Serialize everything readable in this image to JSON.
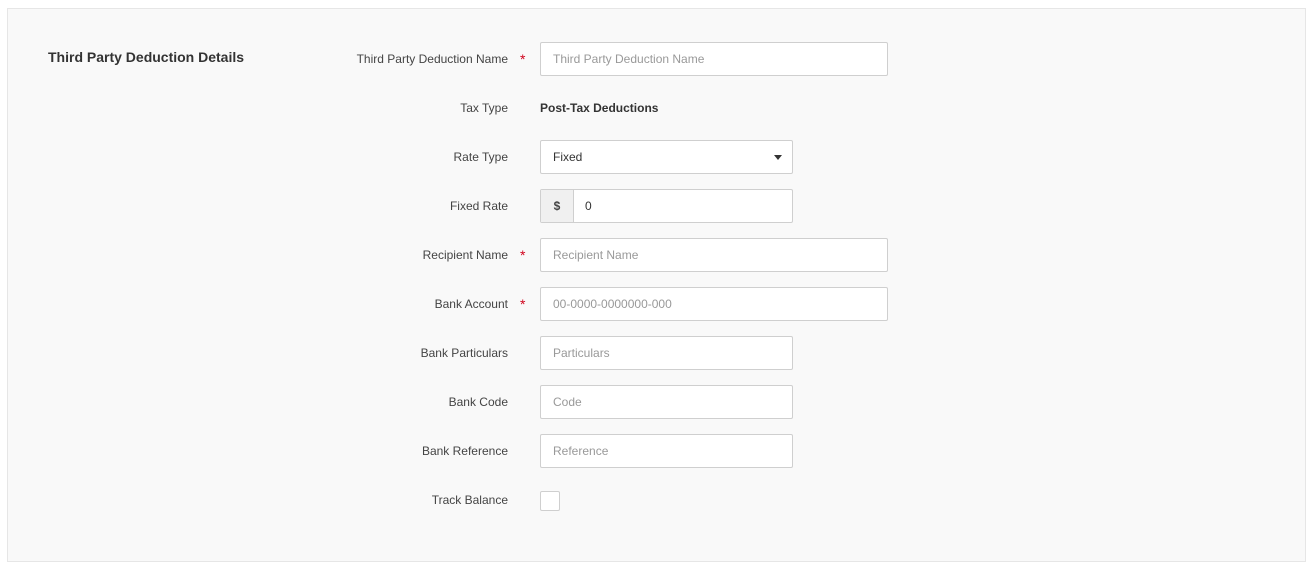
{
  "section": {
    "title": "Third Party Deduction Details"
  },
  "form": {
    "deduction_name": {
      "label": "Third Party Deduction Name",
      "required": "*",
      "placeholder": "Third Party Deduction Name",
      "value": ""
    },
    "tax_type": {
      "label": "Tax Type",
      "value": "Post-Tax Deductions"
    },
    "rate_type": {
      "label": "Rate Type",
      "value": "Fixed"
    },
    "fixed_rate": {
      "label": "Fixed Rate",
      "prefix": "$",
      "value": "0"
    },
    "recipient_name": {
      "label": "Recipient Name",
      "required": "*",
      "placeholder": "Recipient Name",
      "value": ""
    },
    "bank_account": {
      "label": "Bank Account",
      "required": "*",
      "placeholder": "00-0000-0000000-000",
      "value": ""
    },
    "bank_particulars": {
      "label": "Bank Particulars",
      "placeholder": "Particulars",
      "value": ""
    },
    "bank_code": {
      "label": "Bank Code",
      "placeholder": "Code",
      "value": ""
    },
    "bank_reference": {
      "label": "Bank Reference",
      "placeholder": "Reference",
      "value": ""
    },
    "track_balance": {
      "label": "Track Balance",
      "checked": false
    }
  },
  "colors": {
    "required_marker": "#d0021b",
    "border": "#cfcfcf",
    "panel_bg": "#f9f9f9"
  }
}
